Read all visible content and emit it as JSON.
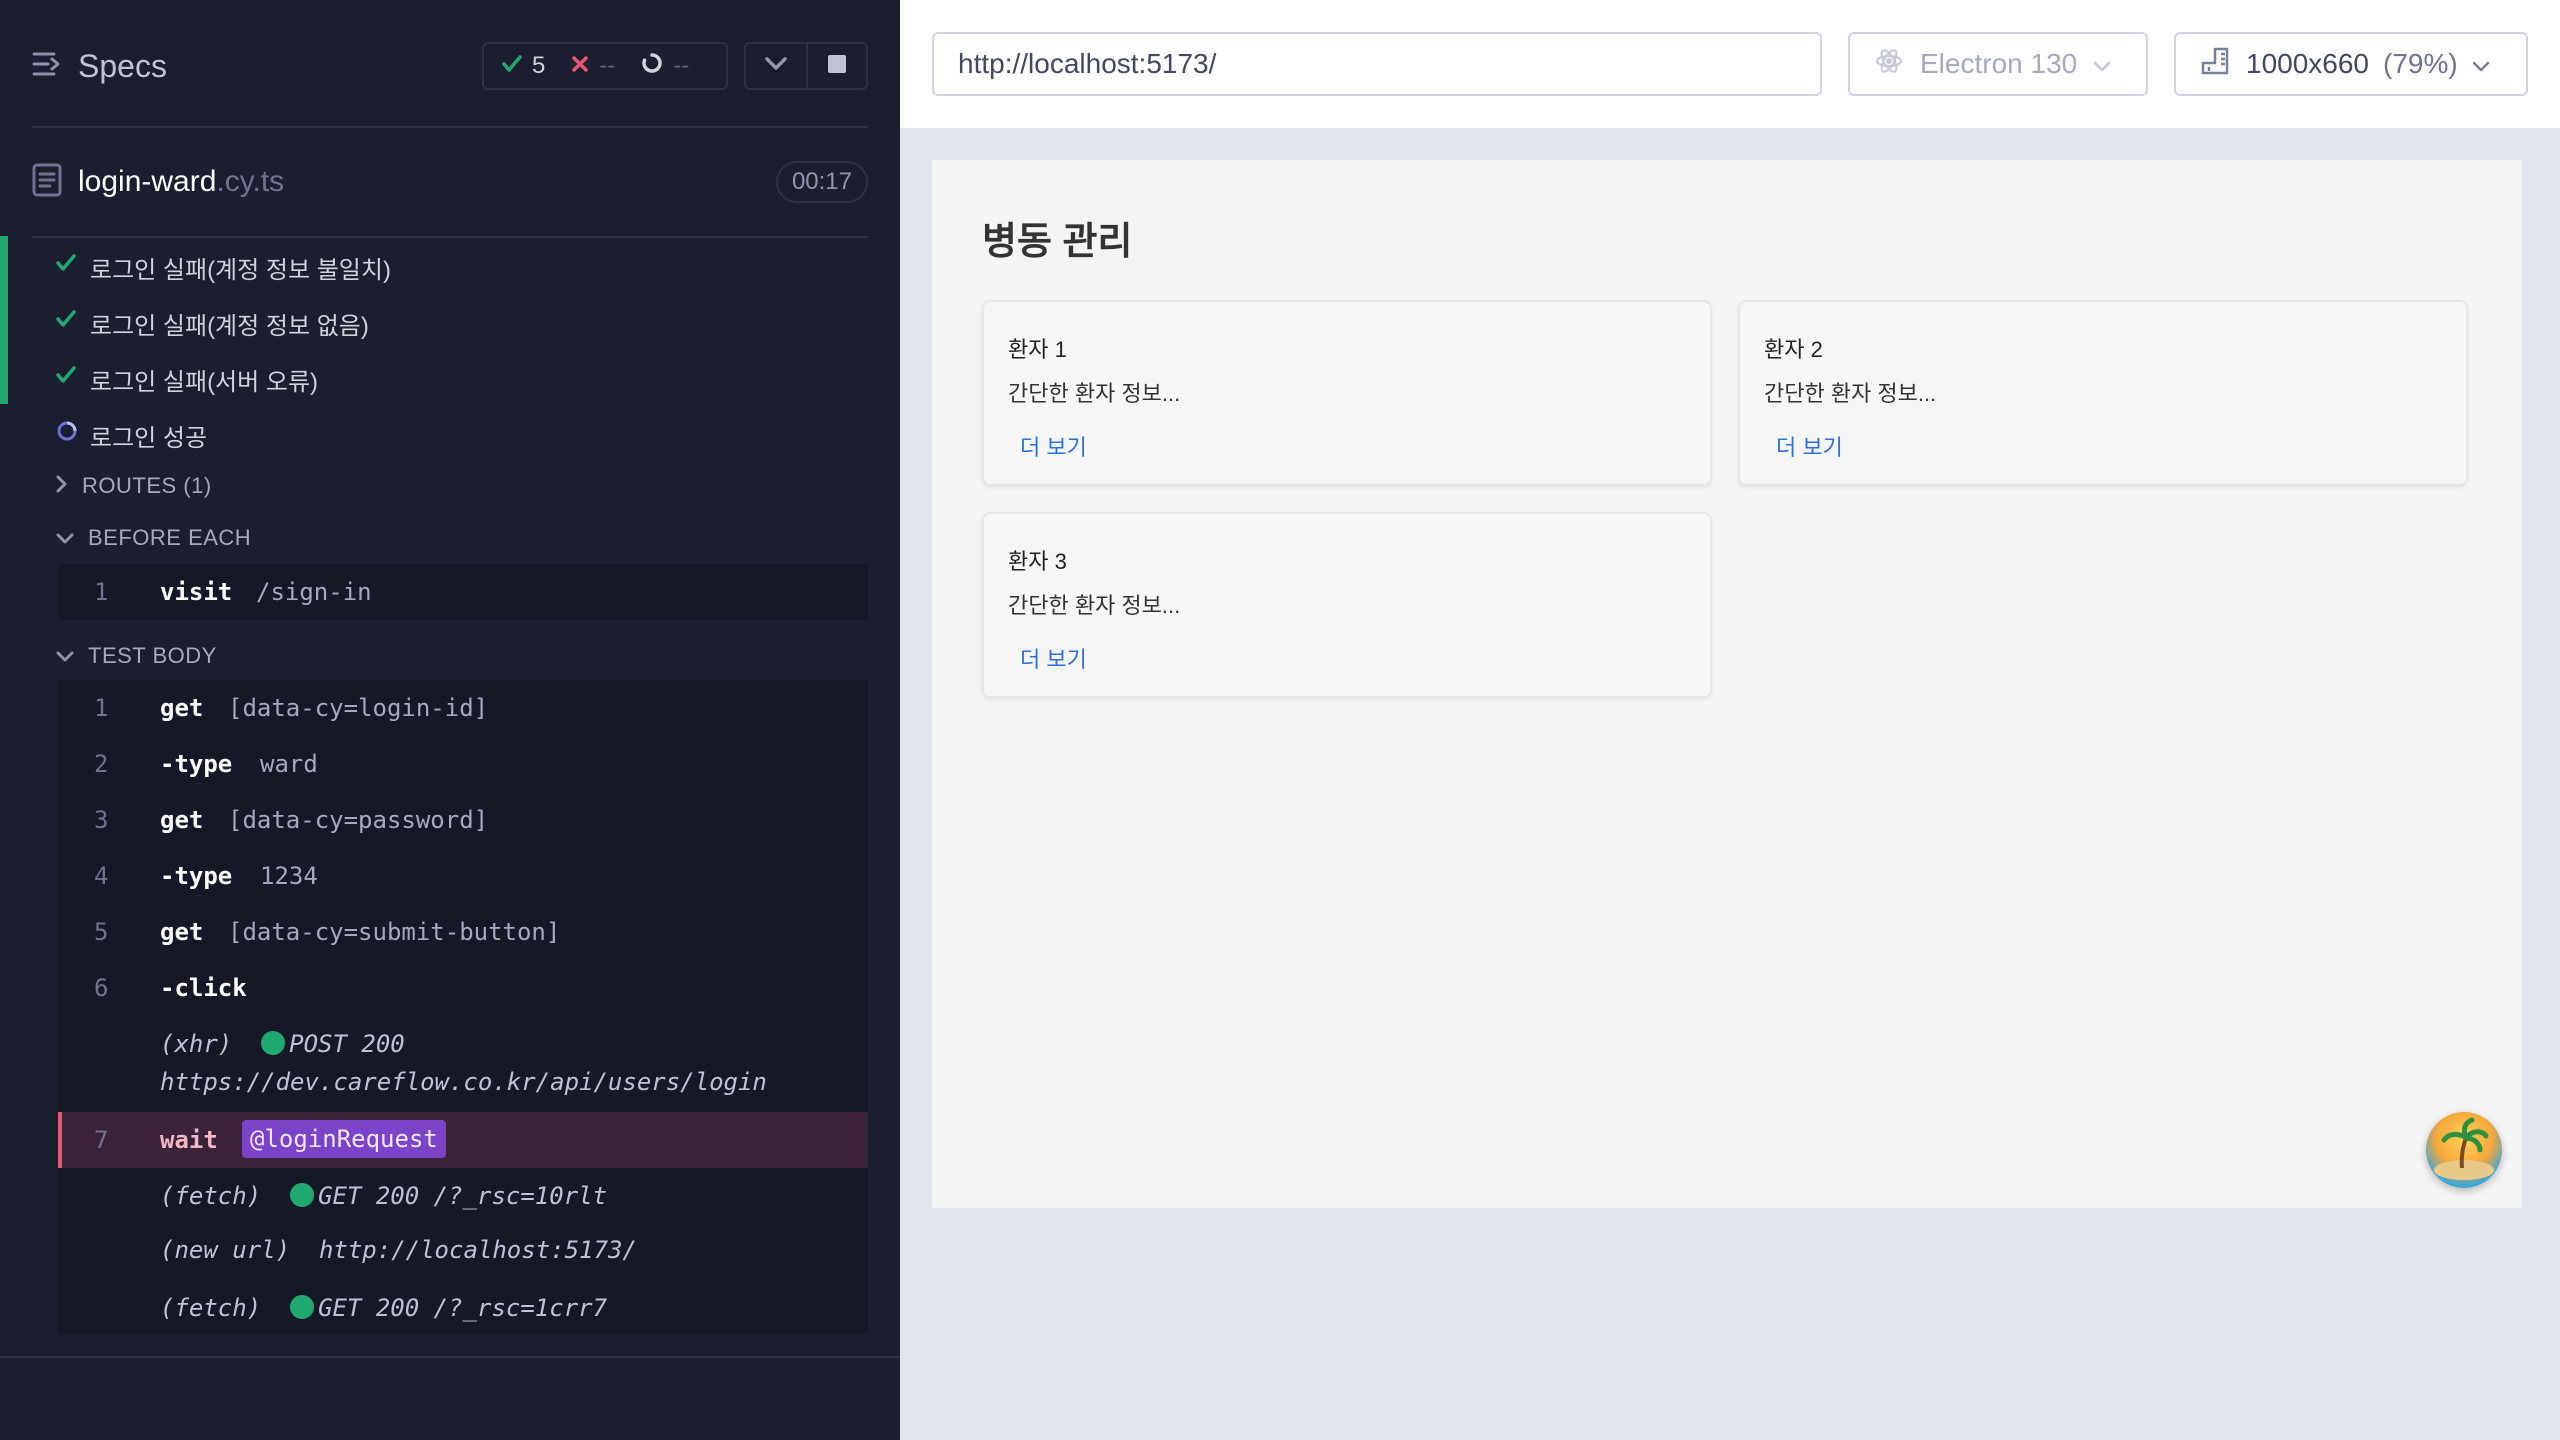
{
  "runner": {
    "specs_label": "Specs",
    "stats": {
      "passed": "5",
      "failed": "--",
      "pending": "--"
    },
    "file": {
      "name": "login-ward",
      "ext": ".cy.ts",
      "duration": "00:17"
    },
    "tests": [
      {
        "label": "로그인 실패(계정 정보 불일치)",
        "state": "passed"
      },
      {
        "label": "로그인 실패(계정 정보 없음)",
        "state": "passed"
      },
      {
        "label": "로그인 실패(서버 오류)",
        "state": "passed"
      },
      {
        "label": "로그인 성공",
        "state": "running"
      }
    ],
    "routes_label": "ROUTES (1)",
    "before_each": {
      "label": "BEFORE EACH",
      "commands": [
        {
          "num": "1",
          "name": "visit",
          "msg": "/sign-in"
        }
      ]
    },
    "test_body": {
      "label": "TEST BODY",
      "commands": [
        {
          "num": "1",
          "name": "get",
          "msg": "[data-cy=login-id]"
        },
        {
          "num": "2",
          "name": "-type",
          "msg": "ward"
        },
        {
          "num": "3",
          "name": "get",
          "msg": "[data-cy=password]"
        },
        {
          "num": "4",
          "name": "-type",
          "msg": "1234"
        },
        {
          "num": "5",
          "name": "get",
          "msg": "[data-cy=submit-button]"
        },
        {
          "num": "6",
          "name": "-click",
          "msg": ""
        },
        {
          "num": "7",
          "name": "wait",
          "msg": "@loginRequest"
        }
      ],
      "logs": {
        "xhr_prefix": "(xhr)",
        "xhr_status": "POST 200",
        "xhr_url": "https://dev.careflow.co.kr/api/users/login",
        "fetch1_prefix": "(fetch)",
        "fetch1_status": "GET 200 /?_rsc=10rlt",
        "newurl_prefix": "(new url)",
        "newurl_value": "http://localhost:5173/",
        "fetch2_prefix": "(fetch)",
        "fetch2_status": "GET 200 /?_rsc=1crr7"
      }
    }
  },
  "aut": {
    "url": "http://localhost:5173/",
    "browser": "Electron 130",
    "viewport": "1000x660",
    "zoom": "(79%)",
    "page": {
      "title": "병동 관리",
      "cards": [
        {
          "title": "환자 1",
          "desc": "간단한 환자 정보...",
          "more": "더 보기"
        },
        {
          "title": "환자 2",
          "desc": "간단한 환자 정보...",
          "more": "더 보기"
        },
        {
          "title": "환자 3",
          "desc": "간단한 환자 정보...",
          "more": "더 보기"
        }
      ]
    }
  },
  "colors": {
    "runner_bg": "#1b1e2e",
    "passed": "#1fa971",
    "failed": "#e45770",
    "alias_bg": "#7b43c8",
    "link": "#2f6fd6"
  }
}
